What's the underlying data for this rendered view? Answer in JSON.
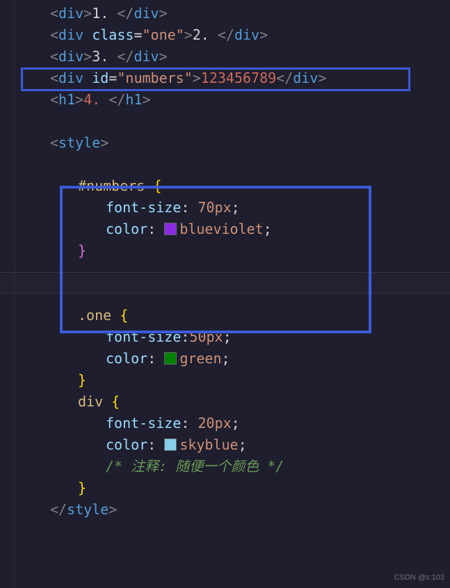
{
  "code": {
    "line1": {
      "open": "<",
      "tag": "div",
      "close_open": ">",
      "text": "1. ",
      "open2": "</",
      "close2": ">"
    },
    "line2": {
      "open": "<",
      "tag": "div",
      "attr": "class",
      "eq": "=",
      "q": "\"",
      "val": "one",
      "close_open": ">",
      "text": "2. ",
      "open2": "</",
      "close2": ">"
    },
    "line3": {
      "open": "<",
      "tag": "div",
      "close_open": ">",
      "text": "3. ",
      "open2": "</",
      "close2": ">"
    },
    "line4": {
      "open": "<",
      "tag": "div",
      "attr": "id",
      "eq": "=",
      "q": "\"",
      "val": "numbers",
      "close_open": ">",
      "text": "123456789",
      "open2": "</",
      "close2": ">"
    },
    "line5": {
      "open": "<",
      "tag": "h1",
      "close_open": ">",
      "text": "4. ",
      "open2": "</",
      "close2": ">"
    },
    "style_open": {
      "open": "<",
      "tag": "style",
      "close": ">"
    },
    "style_close": {
      "open": "</",
      "tag": "style",
      "close": ">"
    },
    "rule_numbers": {
      "selector": "#numbers",
      "brace_open": "{",
      "p1": {
        "prop": "font-size",
        "colon": ": ",
        "val": "70px",
        "semi": ";"
      },
      "p2": {
        "prop": "color",
        "colon": ": ",
        "val": "blueviolet",
        "semi": ";"
      },
      "brace_close": "}"
    },
    "rule_one": {
      "selector": ".one",
      "brace_open": "{",
      "p1": {
        "prop": "font-size",
        "colon": ":",
        "val": "50px",
        "semi": ";"
      },
      "p2": {
        "prop": "color",
        "colon": ": ",
        "val": "green",
        "semi": ";"
      },
      "brace_close": "}"
    },
    "rule_div": {
      "selector": "div",
      "brace_open": "{",
      "p1": {
        "prop": "font-size",
        "colon": ": ",
        "val": "20px",
        "semi": ";"
      },
      "p2": {
        "prop": "color",
        "colon": ": ",
        "val": "skyblue",
        "semi": ";"
      },
      "comment": "/* 注释: 随便一个颜色 */",
      "brace_close": "}"
    }
  },
  "watermark": "CSDN @s:103"
}
